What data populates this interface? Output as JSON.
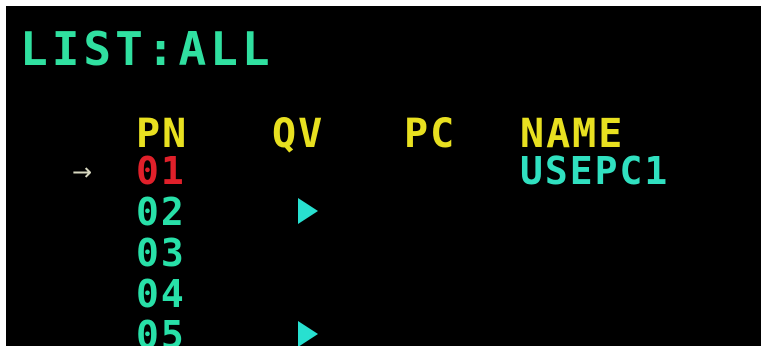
{
  "title": "LIST:ALL",
  "columns": {
    "pn": "PN",
    "qv": "QV",
    "pc": "PC",
    "name": "NAME"
  },
  "selection_indicator": "→",
  "rows": [
    {
      "pn": "01",
      "name": "USEPC1",
      "qv": false,
      "selected": true
    },
    {
      "pn": "02",
      "name": "",
      "qv": true,
      "selected": false
    },
    {
      "pn": "03",
      "name": "",
      "qv": false,
      "selected": false
    },
    {
      "pn": "04",
      "name": "",
      "qv": false,
      "selected": false
    },
    {
      "pn": "05",
      "name": "",
      "qv": true,
      "selected": false
    }
  ],
  "colors": {
    "background": "#000000",
    "title": "#30e0a0",
    "header": "#e8e020",
    "port": "#28e0a8",
    "port_selected": "#e0202a",
    "name": "#30e0c0",
    "qv_marker": "#28e0d0",
    "arrow": "#d8d8c0"
  },
  "icons": {
    "selection": "right-arrow-icon",
    "quick_view": "play-triangle-icon"
  }
}
